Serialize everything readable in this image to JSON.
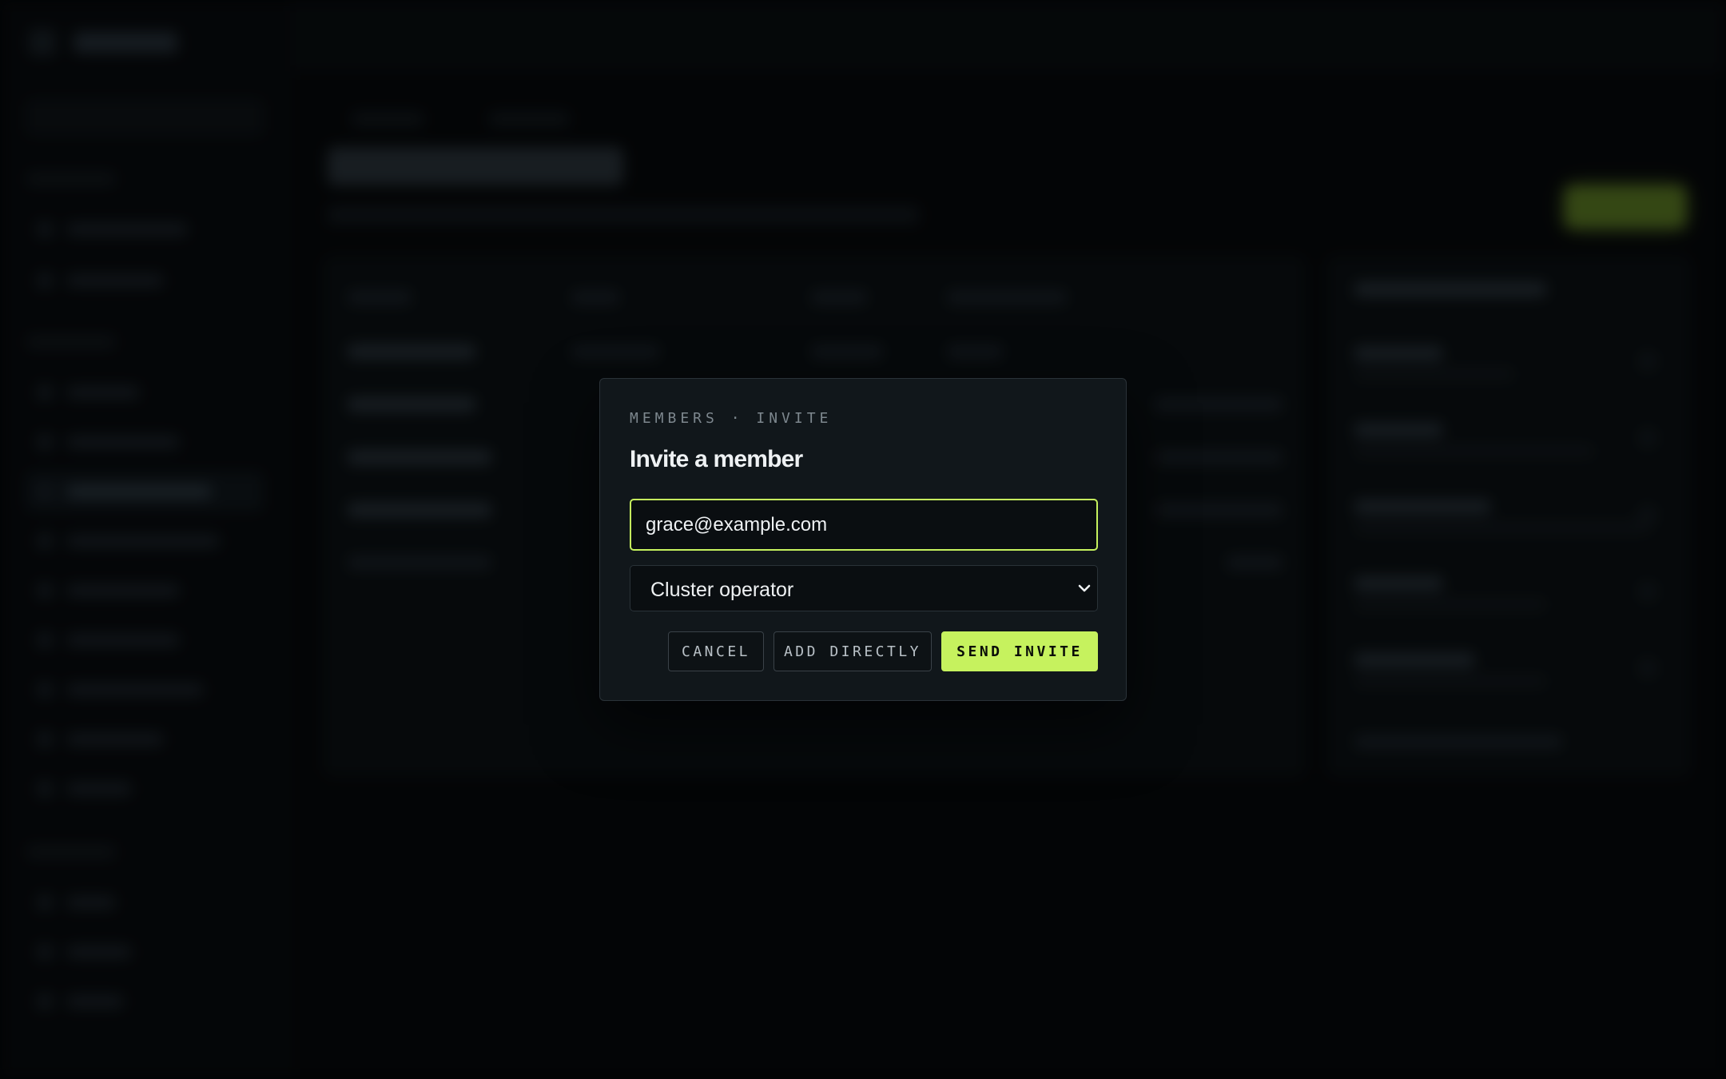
{
  "colors": {
    "accent": "#c6f25e",
    "modal_bg": "#11171b",
    "page_bg": "#040608",
    "text_primary": "#eef1f3",
    "text_muted": "#7d878e"
  },
  "modal": {
    "eyebrow": "MEMBERS · INVITE",
    "title": "Invite a member",
    "email_value": "grace@example.com",
    "role_selected": "Cluster operator",
    "role_chevron_icon": "chevron-down-icon",
    "buttons": {
      "cancel": "CANCEL",
      "add_directly": "ADD DIRECTLY",
      "send_invite": "SEND INVITE"
    }
  }
}
